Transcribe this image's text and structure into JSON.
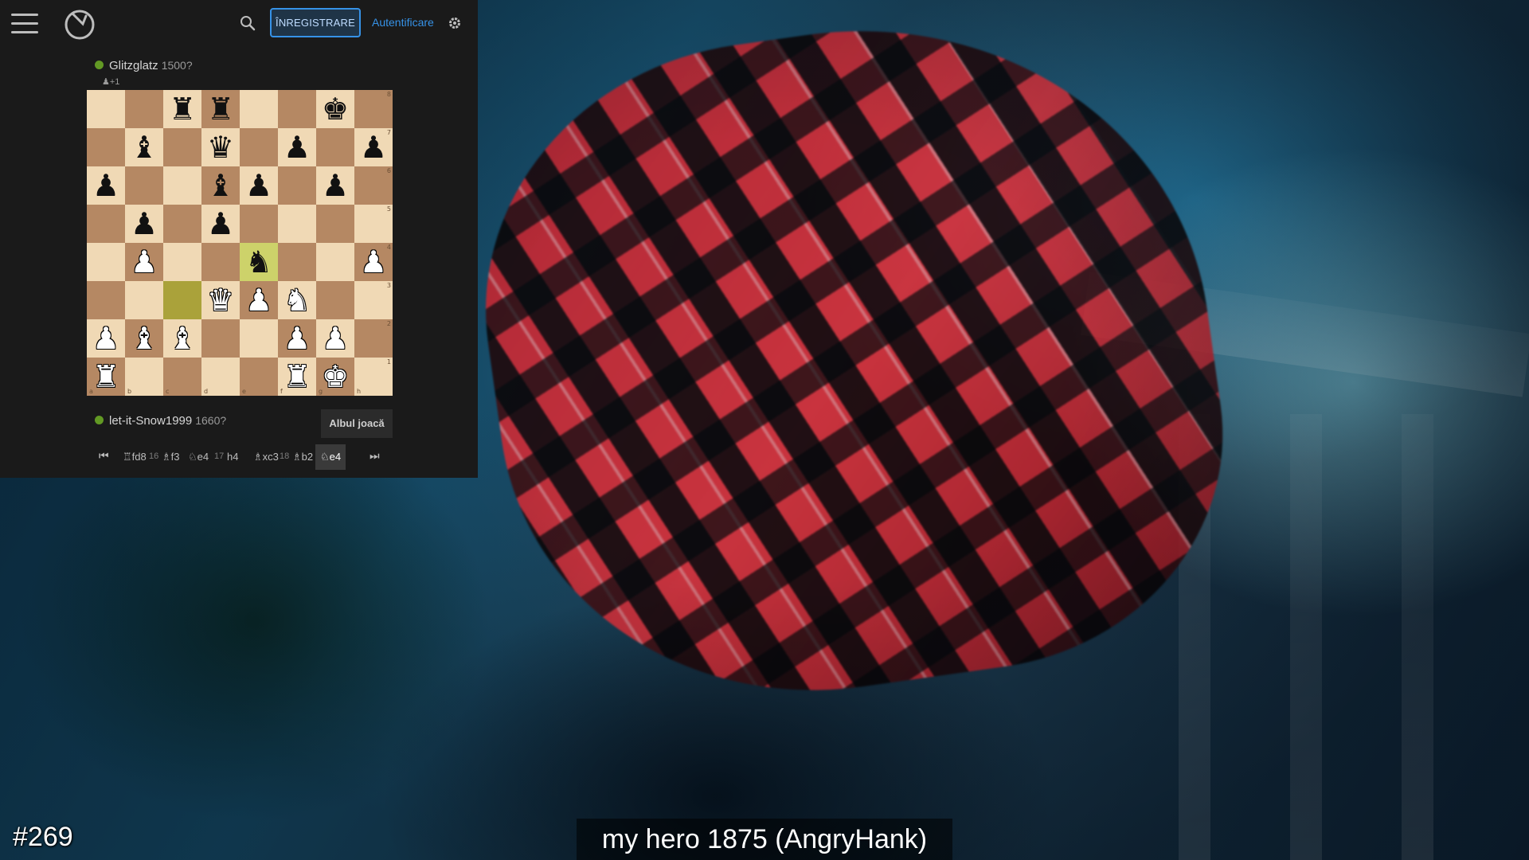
{
  "header": {
    "register_label": "ÎNREGISTRARE",
    "login_label": "Autentificare"
  },
  "players": {
    "top": {
      "name": "Glitzglatz",
      "rating": "1500?",
      "material": "♟+1",
      "online_color": "#629924"
    },
    "bottom": {
      "name": "let-it-Snow1999",
      "rating": "1660?",
      "online_color": "#629924"
    }
  },
  "board": {
    "ranks": [
      [
        "",
        "",
        "r",
        "r",
        "",
        "",
        "k",
        ""
      ],
      [
        "",
        "b",
        "",
        "q",
        "",
        "p",
        "",
        "p"
      ],
      [
        "p",
        "",
        "",
        "b",
        "p",
        "",
        "p",
        ""
      ],
      [
        "",
        "p",
        "",
        "p",
        "",
        "",
        "",
        ""
      ],
      [
        "",
        "P",
        "",
        "",
        "n",
        "",
        "",
        "P"
      ],
      [
        "",
        "",
        "",
        "Q",
        "P",
        "N",
        "",
        ""
      ],
      [
        "P",
        "B",
        "B",
        "",
        "",
        "P",
        "P",
        ""
      ],
      [
        "R",
        "",
        "",
        "",
        "",
        "R",
        "K",
        ""
      ]
    ],
    "highlight": [
      "e4",
      "c3"
    ],
    "rank_labels": [
      "8",
      "7",
      "6",
      "5",
      "4",
      "3",
      "2",
      "1"
    ],
    "file_labels": [
      "a",
      "b",
      "c",
      "d",
      "e",
      "f",
      "g",
      "h"
    ]
  },
  "status": {
    "turn": "Albul joacă"
  },
  "moves": [
    {
      "text": "♖fd8",
      "type": "move"
    },
    {
      "text": "16",
      "type": "num"
    },
    {
      "text": "♗f3",
      "type": "move"
    },
    {
      "text": "♘e4",
      "type": "move"
    },
    {
      "text": "17",
      "type": "num"
    },
    {
      "text": "h4",
      "type": "move"
    },
    {
      "text": "♗xc3",
      "type": "move"
    },
    {
      "text": "18",
      "type": "num"
    },
    {
      "text": "♗b2",
      "type": "move"
    },
    {
      "text": "♘e4",
      "type": "move",
      "current": true
    }
  ],
  "overlay": {
    "episode": "#269",
    "caption": "my hero 1875 (AngryHank)"
  }
}
